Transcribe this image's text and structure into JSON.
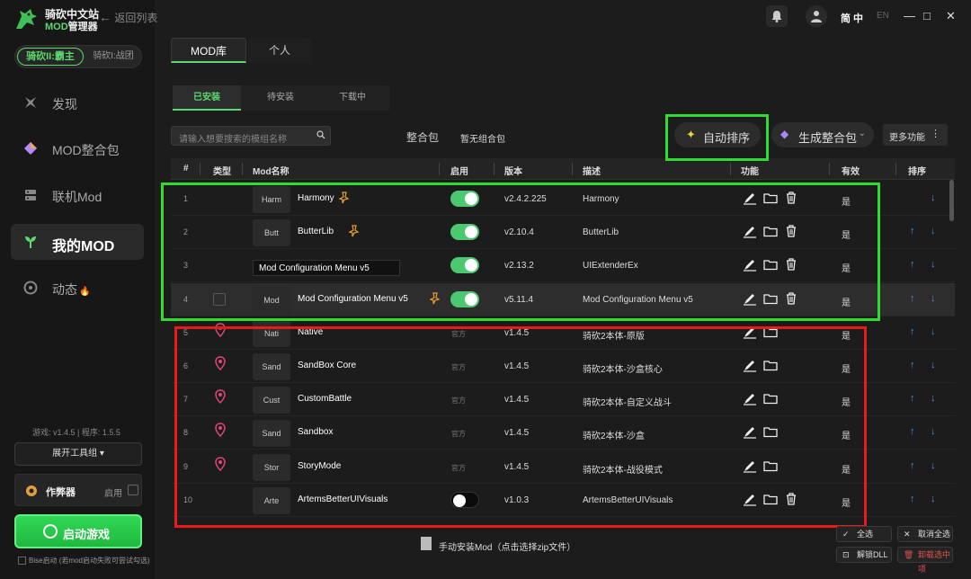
{
  "app": {
    "logo_line1": "骑砍中文站",
    "logo_line2_a": "MOD",
    "logo_line2_b": "管理器",
    "back_label": "返回列表",
    "lang_cn": "简 中",
    "lang_en": "EN",
    "window_controls": [
      "—",
      "□",
      "✕"
    ]
  },
  "game_switch": {
    "active": "骑砍II:霸主",
    "inactive": "骑砍I:战团"
  },
  "nav": [
    {
      "label": "发现",
      "icon": "discover-icon"
    },
    {
      "label": "MOD整合包",
      "icon": "diamond-icon"
    },
    {
      "label": "联机Mod",
      "icon": "server-icon"
    },
    {
      "label": "我的MOD",
      "icon": "sprout-icon",
      "active": true
    },
    {
      "label": "动态",
      "icon": "chat-icon",
      "badge": "🔥"
    }
  ],
  "sidebar_bottom": {
    "version": "游戏: v1.4.5  |  程序: 1.5.5",
    "toolbar_label": "展开工具组 ▾",
    "cheat_label": "作弊器",
    "cheat_toggle_label": "启用",
    "start_label": "启动游戏",
    "bise_label": "Bise启动 (若mod启动失败可尝试勾选)"
  },
  "tabs_top": [
    "MOD库",
    "个人"
  ],
  "tabs_sub": [
    "已安装",
    "待安装",
    "下载中"
  ],
  "search": {
    "placeholder": "请输入想要搜索的模组名称"
  },
  "pack": {
    "label": "整合包",
    "value": "暂无组合包"
  },
  "actions": {
    "auto_sort": "自动排序",
    "gen_pack": "生成整合包",
    "more": "更多功能"
  },
  "table": {
    "headers": [
      "#",
      "类型",
      "Mod名称",
      "启用",
      "版本",
      "描述",
      "功能",
      "有效",
      "排序"
    ],
    "rows": [
      {
        "num": "1",
        "thumb": "Harm",
        "name": "Harmony",
        "starred": true,
        "enabled": "on",
        "version": "v2.4.2.225",
        "desc": "Harmony",
        "valid": "是",
        "up": false,
        "delete": true
      },
      {
        "num": "2",
        "thumb": "Butt",
        "name": "ButterLib",
        "starred": true,
        "enabled": "on",
        "version": "v2.10.4",
        "desc": "ButterLib",
        "valid": "是",
        "up": true,
        "delete": true
      },
      {
        "num": "3",
        "thumb": "",
        "name": "",
        "starred": false,
        "enabled": "on",
        "version": "v2.13.2",
        "desc": "UIExtenderEx",
        "valid": "是",
        "up": true,
        "delete": true
      },
      {
        "num": "4",
        "thumb": "Mod",
        "name": "Mod Configuration Menu v5",
        "starred": true,
        "enabled": "on",
        "version": "v5.11.4",
        "desc": "Mod Configuration Menu v5",
        "valid": "是",
        "up": true,
        "delete": true,
        "checkbox": true,
        "highlight": true
      },
      {
        "num": "5",
        "thumb": "Nati",
        "name": "Native",
        "official": "官方",
        "version": "v1.4.5",
        "desc": "骑砍2本体-原版",
        "valid": "是",
        "up": true,
        "pin": true
      },
      {
        "num": "6",
        "thumb": "Sand",
        "name": "SandBox Core",
        "official": "官方",
        "version": "v1.4.5",
        "desc": "骑砍2本体-沙盒核心",
        "valid": "是",
        "up": true,
        "pin": true
      },
      {
        "num": "7",
        "thumb": "Cust",
        "name": "CustomBattle",
        "official": "官方",
        "version": "v1.4.5",
        "desc": "骑砍2本体-自定义战斗",
        "valid": "是",
        "up": true,
        "pin": true
      },
      {
        "num": "8",
        "thumb": "Sand",
        "name": "Sandbox",
        "official": "官方",
        "version": "v1.4.5",
        "desc": "骑砍2本体-沙盒",
        "valid": "是",
        "up": true,
        "pin": true
      },
      {
        "num": "9",
        "thumb": "Stor",
        "name": "StoryMode",
        "official": "官方",
        "version": "v1.4.5",
        "desc": "骑砍2本体-战役模式",
        "valid": "是",
        "up": true,
        "pin": true
      },
      {
        "num": "10",
        "thumb": "Arte",
        "name": "ArtemsBetterUIVisuals",
        "enabled": "off",
        "version": "v1.0.3",
        "desc": "ArtemsBetterUIVisuals",
        "valid": "是",
        "up": true,
        "delete": true
      }
    ]
  },
  "tooltip": "Mod Configuration Menu v5",
  "bottom": {
    "install_label": "手动安装Mod（点击选择zip文件）",
    "select_all": "全选",
    "cancel_all": "取消全选",
    "unlock_dll": "解锁DLL",
    "uninstall_selected": "卸载选中项"
  },
  "colors": {
    "accent": "#5bd96e",
    "green_box": "#2fdc2f",
    "red_box": "#e81b1b",
    "sort_arrow": "#4a90e2"
  }
}
